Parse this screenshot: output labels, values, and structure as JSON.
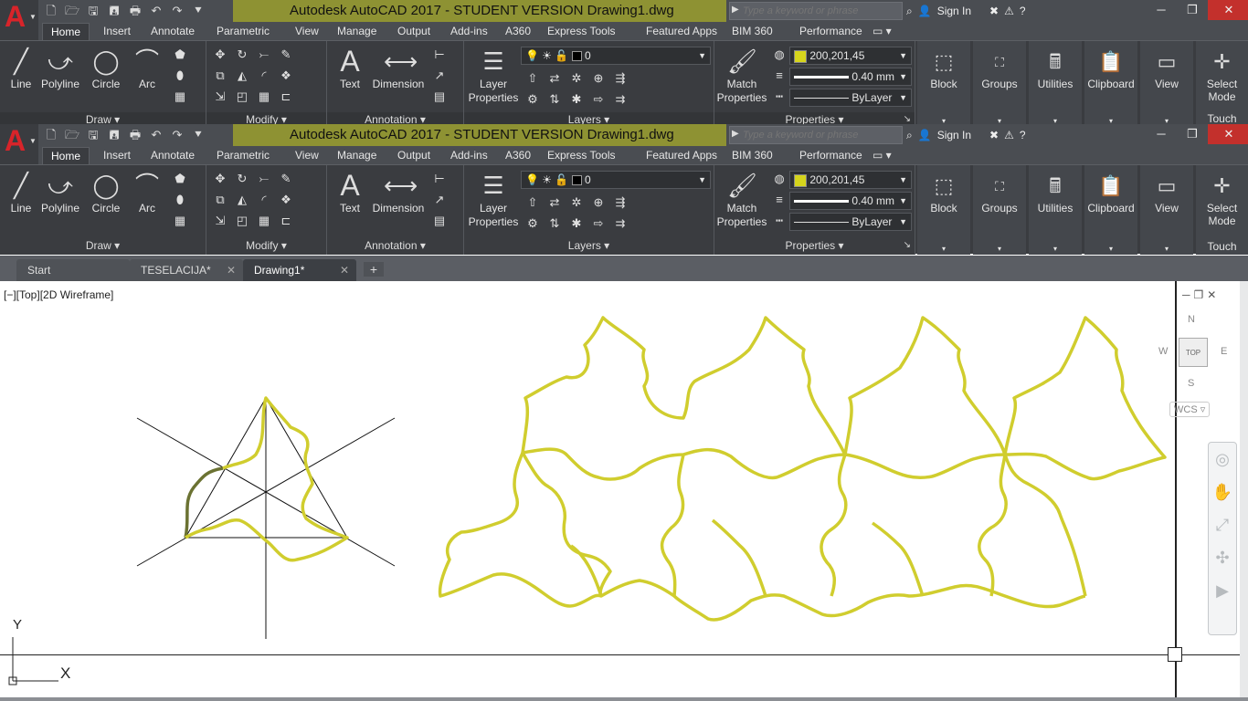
{
  "app": {
    "logo": "A",
    "title": "Autodesk AutoCAD 2017 - STUDENT VERSION    Drawing1.dwg",
    "search_placeholder": "Type a keyword or phrase",
    "sign_in": "Sign In",
    "help": "?"
  },
  "ribbon_tabs": [
    "Home",
    "Insert",
    "Annotate",
    "Parametric",
    "View",
    "Manage",
    "Output",
    "Add-ins",
    "A360",
    "Express Tools",
    "Featured Apps",
    "BIM 360",
    "Performance"
  ],
  "draw": {
    "title": "Draw",
    "line": "Line",
    "polyline": "Polyline",
    "circle": "Circle",
    "arc": "Arc"
  },
  "modify": {
    "title": "Modify"
  },
  "annotation": {
    "title": "Annotation",
    "text": "Text",
    "dimension": "Dimension"
  },
  "layers": {
    "title": "Layers",
    "layer_properties_1": "Layer",
    "layer_properties_2": "Properties",
    "current_layer": "0"
  },
  "properties": {
    "title": "Properties",
    "match_1": "Match",
    "match_2": "Properties",
    "color_value": "200,201,45",
    "lineweight": "0.40 mm",
    "linetype": "ByLayer",
    "color_swatch": "#d6d51c"
  },
  "right_panels": {
    "block": "Block",
    "groups": "Groups",
    "utilities": "Utilities",
    "clipboard": "Clipboard",
    "view": "View",
    "select_1": "Select",
    "select_2": "Mode",
    "touch": "Touch"
  },
  "doc_tabs": [
    {
      "label": "Start"
    },
    {
      "label": "TESELACIJA*"
    },
    {
      "label": "Drawing1*"
    }
  ],
  "viewport": {
    "label": "[−][Top][2D Wireframe]",
    "top": "TOP",
    "n": "N",
    "s": "S",
    "e": "E",
    "w": "W",
    "wcs": "WCS ▿"
  },
  "ucs": {
    "y": "Y",
    "x": "X"
  },
  "colors": {
    "accent": "#d0cd2e",
    "title_bar": "#8e9233",
    "close": "#c3302c"
  }
}
